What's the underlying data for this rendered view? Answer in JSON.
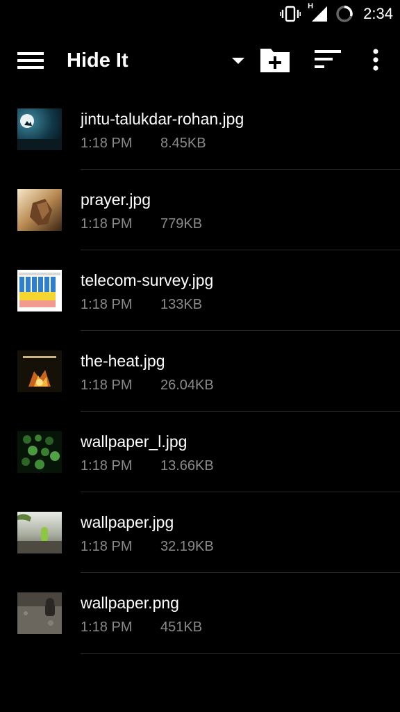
{
  "status_bar": {
    "time": "2:34",
    "network_label": "H",
    "icons": [
      "vibrate-icon",
      "signal-icon",
      "battery-icon"
    ]
  },
  "app_bar": {
    "title": "Hide It",
    "icons": [
      "menu-icon",
      "dropdown-arrow-icon",
      "new-folder-icon",
      "sort-icon",
      "more-vert-icon"
    ]
  },
  "files": [
    {
      "name": "jintu-talukdar-rohan.jpg",
      "time": "1:18 PM",
      "size": "8.45KB"
    },
    {
      "name": "prayer.jpg",
      "time": "1:18 PM",
      "size": "779KB"
    },
    {
      "name": "telecom-survey.jpg",
      "time": "1:18 PM",
      "size": "133KB"
    },
    {
      "name": "the-heat.jpg",
      "time": "1:18 PM",
      "size": "26.04KB"
    },
    {
      "name": "wallpaper_l.jpg",
      "time": "1:18 PM",
      "size": "13.66KB"
    },
    {
      "name": "wallpaper.jpg",
      "time": "1:18 PM",
      "size": "32.19KB"
    },
    {
      "name": "wallpaper.png",
      "time": "1:18 PM",
      "size": "451KB"
    }
  ],
  "colors": {
    "background": "#000000",
    "primary_text": "#ffffff",
    "secondary_text": "#8a8a8a",
    "divider": "#2a2a2a"
  }
}
